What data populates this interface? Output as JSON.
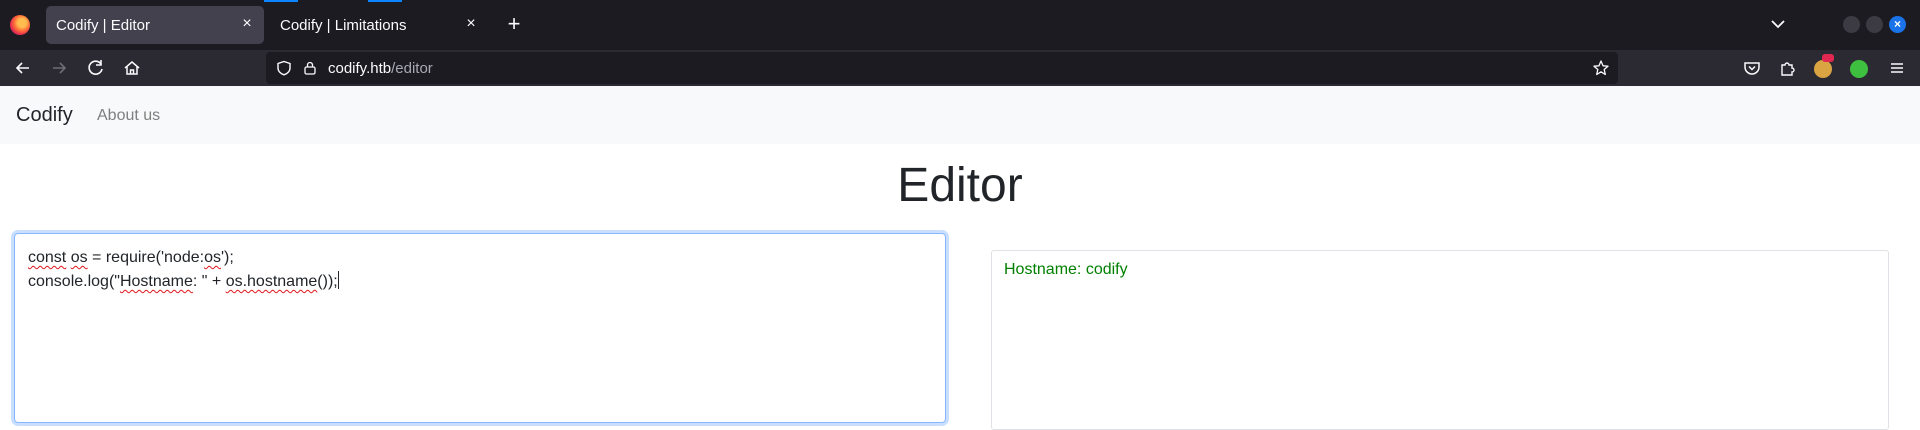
{
  "browser": {
    "tabs": [
      {
        "title": "Codify | Editor",
        "active": true
      },
      {
        "title": "Codify | Limitations",
        "active": false
      }
    ],
    "url": {
      "host": "codify.htb",
      "path": "/editor"
    },
    "icons": {
      "logo": "firefox-logo-icon",
      "close": "×",
      "new_tab": "+",
      "back": "back-arrow-icon",
      "forward": "forward-arrow-icon",
      "reload": "reload-icon",
      "home": "home-icon",
      "shield": "tracking-protection-shield-icon",
      "lock": "lock-icon",
      "star": "bookmark-star-icon",
      "pocket": "pocket-icon",
      "extensions": "extensions-puzzle-icon",
      "menu": "hamburger-menu-icon"
    }
  },
  "site": {
    "brand": "Codify",
    "nav_links": [
      "About us"
    ]
  },
  "editor": {
    "title": "Editor",
    "code_lines": [
      [
        {
          "text": "const",
          "squiggle": true
        },
        {
          "text": " ",
          "squiggle": false
        },
        {
          "text": "os",
          "squiggle": true
        },
        {
          "text": " = require('node:",
          "squiggle": false
        },
        {
          "text": "os",
          "squiggle": true
        },
        {
          "text": "');",
          "squiggle": false
        }
      ],
      [
        {
          "text": "console.log(\"",
          "squiggle": false
        },
        {
          "text": "Hostname",
          "squiggle": true
        },
        {
          "text": ": \" + ",
          "squiggle": false
        },
        {
          "text": "os.hostname",
          "squiggle": true
        },
        {
          "text": "());",
          "squiggle": false
        }
      ]
    ]
  },
  "output": {
    "text": "Hostname: codify",
    "color": "#008000"
  },
  "colors": {
    "tabbar_bg": "#1c1b22",
    "navbar_bg": "#2b2a33",
    "active_tab_bg": "#42414d",
    "accent": "#0a84ff",
    "site_nav_bg": "#f8f9fa"
  }
}
